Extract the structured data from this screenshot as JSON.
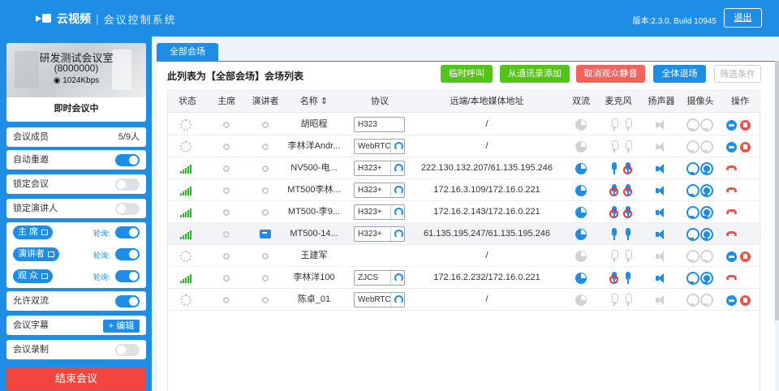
{
  "header": {
    "app_name": "云视频",
    "app_subtitle": "会议控制系统",
    "version": "版本:2.3.0, Build 10945",
    "logout_label": "退出"
  },
  "sidebar": {
    "room_name": "研发测试会议室",
    "room_number": "(8000000)",
    "bitrate": "1024Kbps",
    "meeting_status": "即时会议中",
    "members_label": "会议成员",
    "members_value": "5/9人",
    "auto_redial_label": "自动重邀",
    "auto_redial": true,
    "lock_meeting_label": "锁定会议",
    "lock_meeting": false,
    "lock_presenter_label": "锁定演讲人",
    "lock_presenter": false,
    "roles": [
      {
        "label": "主 席",
        "poll_label": "轮询:",
        "on": true
      },
      {
        "label": "演讲者",
        "poll_label": "轮询:",
        "on": true
      },
      {
        "label": "观 众",
        "poll_label": "轮询:",
        "on": true
      }
    ],
    "dual_stream_label": "允许双流",
    "dual_stream": true,
    "subtitle_label": "会议字幕",
    "subtitle_edit_label": "+ 编辑",
    "record_label": "会议录制",
    "record": false,
    "end_button": "结束会议"
  },
  "main": {
    "tab_label": "全部会场",
    "list_title": "此列表为【全部会场】会场列表",
    "buttons": {
      "temp_call": "临时呼叫",
      "add_contacts": "从通讯录添加",
      "unmute_audience": "取消观众静音",
      "all_leave": "全体退场",
      "filter": "筛选条件"
    },
    "colors": {
      "primary": "#1e8de6",
      "green": "#52c41a",
      "red": "#f0524a"
    },
    "columns": [
      "状态",
      "主席",
      "演讲者",
      "名称 ⇕",
      "协议",
      "远端/本地媒体地址",
      "双流",
      "麦克风",
      "扬声器",
      "摄像头",
      "操作"
    ],
    "rows": [
      {
        "online": false,
        "presenter": false,
        "name": "胡昭程",
        "protocol": "H323",
        "proto_icon": false,
        "address": "/",
        "dual": false,
        "mic1": "off",
        "mic2": "off",
        "speaker": false,
        "cam1": "off",
        "cam2": "off",
        "ops": "call-delete"
      },
      {
        "online": false,
        "presenter": false,
        "name": "李林洋Andr...",
        "protocol": "WebRTC",
        "proto_icon": true,
        "address": "/",
        "dual": false,
        "mic1": "off",
        "mic2": "off",
        "speaker": false,
        "cam1": "off",
        "cam2": "off",
        "ops": "call-delete"
      },
      {
        "online": true,
        "presenter": false,
        "name": "NV500-电...",
        "protocol": "H323+",
        "proto_icon": true,
        "address": "222.130.132.207/61.135.195.246",
        "dual": true,
        "mic1": "on",
        "mic2": "mute",
        "speaker": true,
        "cam1": "on",
        "cam2": "fill",
        "ops": "hangup"
      },
      {
        "online": true,
        "presenter": false,
        "name": "MT500李林...",
        "protocol": "H323+",
        "proto_icon": true,
        "address": "172.16.3.109/172.16.0.221",
        "dual": true,
        "mic1": "mute",
        "mic2": "mute",
        "speaker": true,
        "cam1": "on",
        "cam2": "fill",
        "ops": "hangup"
      },
      {
        "online": true,
        "presenter": false,
        "name": "MT500-李9...",
        "protocol": "H323+",
        "proto_icon": true,
        "address": "172.16.2.143/172.16.0.221",
        "dual": true,
        "mic1": "mute",
        "mic2": "mute",
        "speaker": true,
        "cam1": "on",
        "cam2": "fill",
        "ops": "hangup"
      },
      {
        "online": true,
        "presenter": true,
        "name": "MT500-14...",
        "protocol": "H323+",
        "proto_icon": true,
        "address": "61.135.195.247/61.135.195.246",
        "dual": true,
        "mic1": "on",
        "mic2": "on",
        "speaker": true,
        "cam1": "on",
        "cam2": "fill",
        "ops": "hangup"
      },
      {
        "online": false,
        "presenter": false,
        "name": "王建军",
        "protocol": "",
        "proto_icon": false,
        "address": "/",
        "dual": false,
        "mic1": "off",
        "mic2": "off",
        "speaker": false,
        "cam1": "off",
        "cam2": "off",
        "ops": "call-delete"
      },
      {
        "online": true,
        "presenter": false,
        "name": "李林洋100",
        "protocol": "ZJCS",
        "proto_icon": true,
        "address": "172.16.2.232/172.16.0.221",
        "dual": true,
        "mic1": "mute",
        "mic2": "on",
        "speaker": true,
        "cam1": "on",
        "cam2": "fill",
        "ops": "hangup"
      },
      {
        "online": false,
        "presenter": false,
        "name": "陈卓_01",
        "protocol": "WebRTC",
        "proto_icon": true,
        "address": "/",
        "dual": false,
        "mic1": "off",
        "mic2": "off",
        "speaker": false,
        "cam1": "off",
        "cam2": "off",
        "ops": "call-delete"
      }
    ]
  }
}
